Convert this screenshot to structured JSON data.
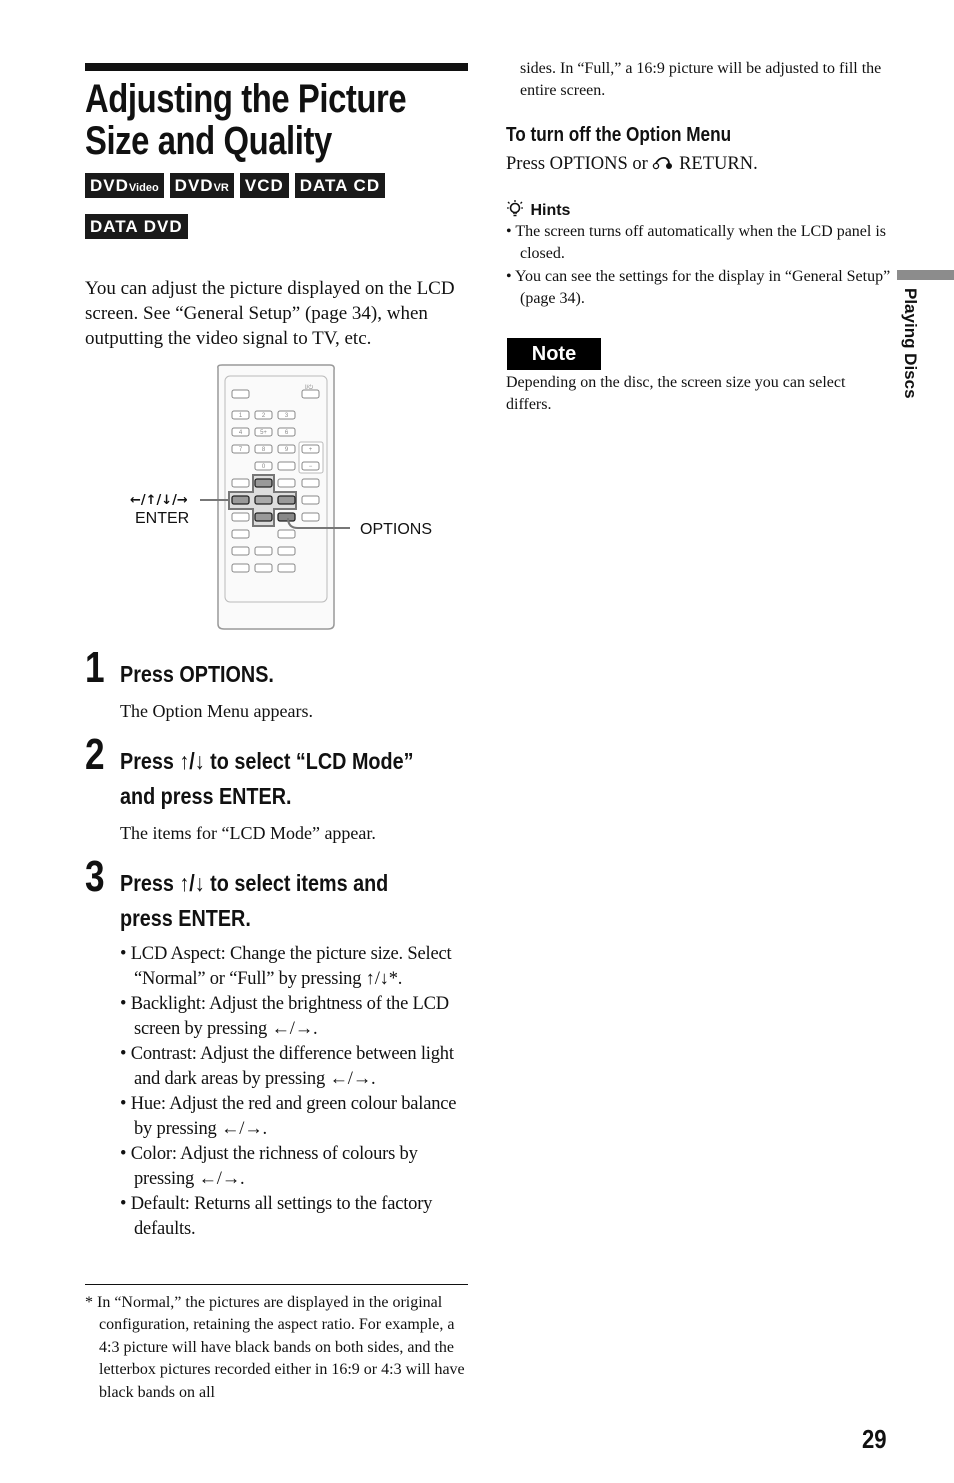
{
  "title": "Adjusting the Picture Size and Quality",
  "title_lines": [
    "Adjusting the Picture",
    "Size and Quality"
  ],
  "badges": [
    {
      "main": "DVD",
      "sub": "Video"
    },
    {
      "main": "DVD",
      "sub": "VR"
    },
    {
      "main": "VCD",
      "sub": ""
    },
    {
      "main": "DATA CD",
      "sub": ""
    },
    {
      "main": "DATA DVD",
      "sub": ""
    }
  ],
  "intro": "You can adjust the picture displayed on the LCD screen. See “General Setup” (page 34), when outputting the video signal to TV, etc.",
  "illustration": {
    "label_arrows": "←/↑/↓/→",
    "label_enter": "ENTER",
    "label_options": "OPTIONS",
    "power_label": "I/⏻",
    "keys": [
      "1",
      "2",
      "3",
      "4",
      "5+",
      "6",
      "7",
      "8",
      "9",
      "0",
      "+",
      "−"
    ]
  },
  "steps": [
    {
      "number": "1",
      "heading": "Press OPTIONS.",
      "body": "The Option Menu appears."
    },
    {
      "number": "2",
      "heading_lines": [
        "Press ↑/↓ to select “LCD Mode”",
        "and press ENTER."
      ],
      "body": "The items for “LCD Mode” appear."
    },
    {
      "number": "3",
      "heading_lines": [
        "Press ↑/↓ to select items and",
        "press ENTER."
      ]
    }
  ],
  "items": [
    "LCD Aspect: Change the picture size. Select “Normal” or “Full” by pressing ↑/↓*.",
    "Backlight: Adjust the brightness of the LCD screen by pressing ←/→.",
    "Contrast: Adjust the difference between light and dark areas by pressing ←/→.",
    "Hue: Adjust the red and green colour balance by pressing ←/→.",
    "Color: Adjust the richness of colours by pressing ←/→.",
    "Default: Returns all settings to the factory defaults."
  ],
  "footnote": "* In “Normal,” the pictures are displayed in the original configuration, retaining the aspect ratio. For example, a 4:3 picture will have black bands on both sides, and the letterbox pictures recorded either in 16:9 or 4:3 will have black bands on all",
  "footnote_cont": "sides. In “Full,” a 16:9 picture will be adjusted to fill the entire screen.",
  "turn_off": {
    "heading": "To turn off the Option Menu",
    "text_before": "Press OPTIONS or ",
    "text_after": " RETURN."
  },
  "hints": {
    "heading": "Hints",
    "items": [
      "The screen turns off automatically when the LCD panel is closed.",
      "You can see the settings for the display in “General Setup” (page 34)."
    ]
  },
  "note": {
    "label": "Note",
    "text": "Depending on the disc, the screen size you can select differs."
  },
  "side_label": "Playing Discs",
  "page_number": "29"
}
